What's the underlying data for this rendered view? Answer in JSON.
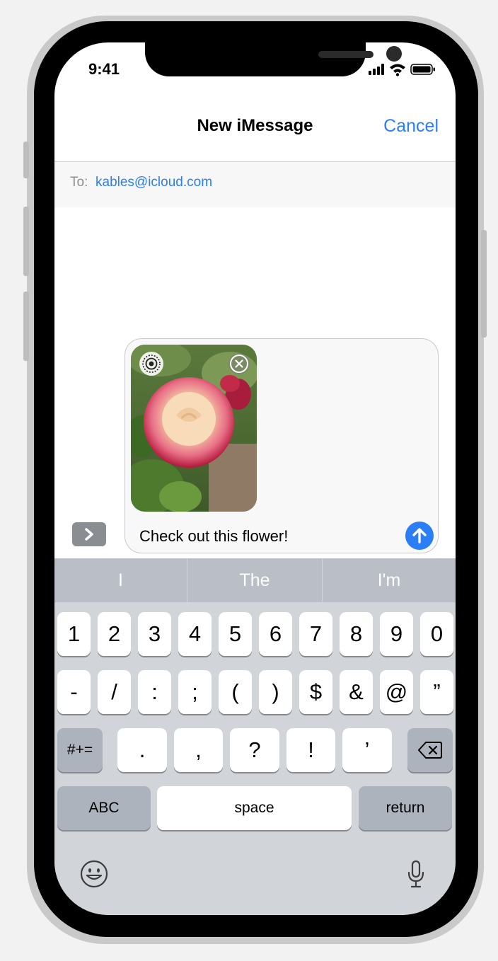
{
  "status_bar": {
    "time": "9:41"
  },
  "nav": {
    "title": "New iMessage",
    "cancel_label": "Cancel"
  },
  "recipient": {
    "to_label": "To:",
    "address": "kables@icloud.com"
  },
  "compose": {
    "text": "Check out this flower!"
  },
  "predictive": [
    "I",
    "The",
    "I'm"
  ],
  "keyboard": {
    "row1": [
      "1",
      "2",
      "3",
      "4",
      "5",
      "6",
      "7",
      "8",
      "9",
      "0"
    ],
    "row2": [
      "-",
      "/",
      ":",
      ";",
      "(",
      ")",
      "$",
      "&",
      "@",
      "”"
    ],
    "row3_left": "#+=",
    "row3_keys": [
      ".",
      ",",
      "?",
      "!",
      "’"
    ],
    "abc_label": "ABC",
    "space_label": "space",
    "return_label": "return"
  },
  "colors": {
    "accent": "#2a7ef6",
    "keyboard_bg": "#d1d4d9",
    "predictive_bg": "#b9bec7"
  }
}
